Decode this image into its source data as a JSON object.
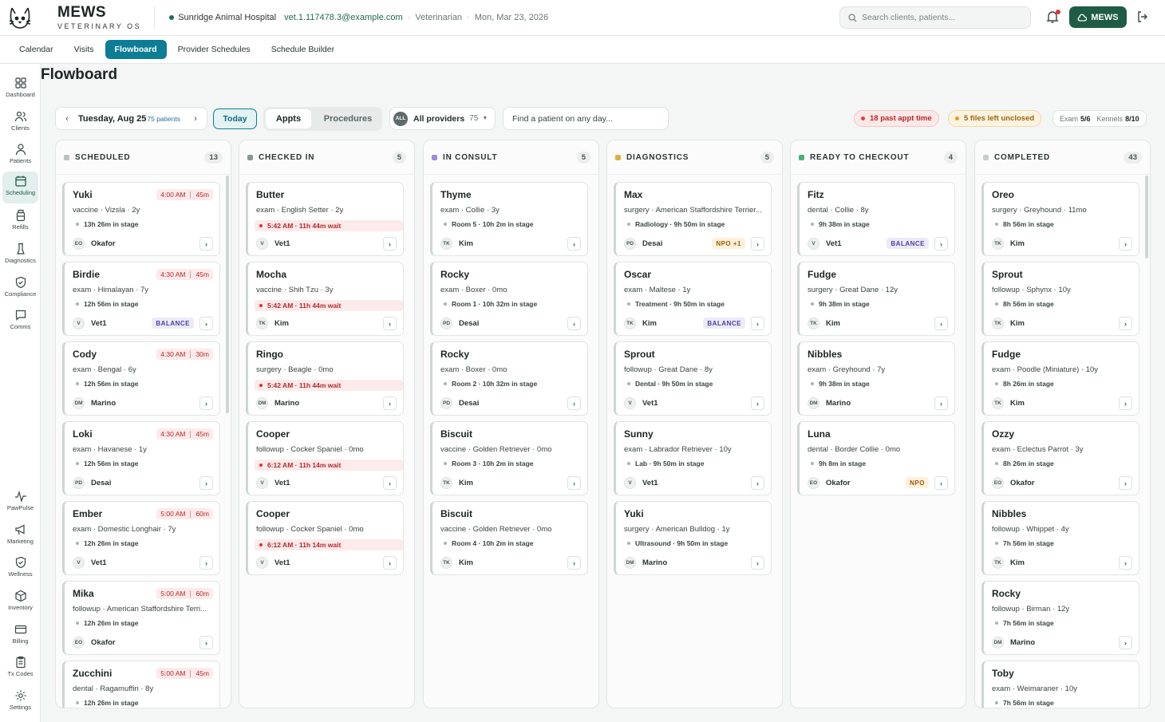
{
  "app": {
    "brand": "MEWS",
    "brand_sub": "VETERINARY OS"
  },
  "header": {
    "hospital": "Sunridge Animal Hospital",
    "user_email": "vet.1.117478.3@example.com",
    "role": "Veterinarian",
    "date": "Mon, Mar 23, 2026",
    "search_placeholder": "Search clients, patients...",
    "mews_button": "MEWS"
  },
  "nav_tabs": [
    {
      "label": "Calendar",
      "active": false
    },
    {
      "label": "Visits",
      "active": false
    },
    {
      "label": "Flowboard",
      "active": true
    },
    {
      "label": "Provider Schedules",
      "active": false
    },
    {
      "label": "Schedule Builder",
      "active": false
    }
  ],
  "sidebar": {
    "items": [
      {
        "label": "Dashboard",
        "icon": "grid-icon"
      },
      {
        "label": "Clients",
        "icon": "users-icon"
      },
      {
        "label": "Patients",
        "icon": "user-icon"
      },
      {
        "label": "Scheduling",
        "icon": "calendar-icon",
        "active": true
      },
      {
        "label": "Refills",
        "icon": "bottle-icon"
      },
      {
        "label": "Diagnostics",
        "icon": "flask-icon"
      },
      {
        "label": "Compliance",
        "icon": "shield-check-icon"
      },
      {
        "label": "Comms",
        "icon": "chat-icon"
      },
      {
        "label": "PawPulse",
        "icon": "pulse-icon"
      },
      {
        "label": "Marketing",
        "icon": "megaphone-icon"
      },
      {
        "label": "Wellness",
        "icon": "shield-check-icon"
      },
      {
        "label": "Inventory",
        "icon": "box-icon"
      },
      {
        "label": "Billing",
        "icon": "card-icon"
      },
      {
        "label": "Tx Codes",
        "icon": "clipboard-icon"
      },
      {
        "label": "Settings",
        "icon": "gear-icon"
      }
    ]
  },
  "page": {
    "title": "Flowboard"
  },
  "toolbar": {
    "date": "Tuesday, Aug 25",
    "patient_count": "75 patients",
    "today": "Today",
    "segment_on": "Appts",
    "segment_off": "Procedures",
    "providers_badge": "ALL",
    "providers_label": "All providers",
    "providers_count": "75",
    "find_placeholder": "Find a patient on any day...",
    "past_appt": "18 past appt time",
    "files_unclosed": "5 files left unclosed",
    "exam_label": "Exam",
    "exam_value": "5/6",
    "kennels_label": "Kennels",
    "kennels_value": "8/10"
  },
  "colors": {
    "accent": "#0d7d96",
    "brand": "#1f5c45",
    "scheduled": "#b9c2c2",
    "checked_in": "#8a9797",
    "in_consult": "#9c8ce0",
    "diagnostics": "#e0b040",
    "ready": "#4cb07a",
    "completed": "#c5cccc"
  },
  "columns": [
    {
      "title": "SCHEDULED",
      "count": "13",
      "cards": [
        {
          "name": "Yuki",
          "time": "4:00 AM",
          "dur": "45m",
          "desc": "vaccine · Vizsla · 2y",
          "stage": "13h 26m in stage",
          "initials": "EO",
          "provider": "Okafor",
          "badge": ""
        },
        {
          "name": "Birdie",
          "time": "4:30 AM",
          "dur": "45m",
          "desc": "exam · Himalayan · 7y",
          "stage": "12h 56m in stage",
          "initials": "V",
          "provider": "Vet1",
          "badge": "BALANCE"
        },
        {
          "name": "Cody",
          "time": "4:30 AM",
          "dur": "30m",
          "desc": "exam · Bengal · 6y",
          "stage": "12h 56m in stage",
          "initials": "DM",
          "provider": "Marino",
          "badge": ""
        },
        {
          "name": "Loki",
          "time": "4:30 AM",
          "dur": "45m",
          "desc": "exam · Havanese · 1y",
          "stage": "12h 56m in stage",
          "initials": "PD",
          "provider": "Desai",
          "badge": ""
        },
        {
          "name": "Ember",
          "time": "5:00 AM",
          "dur": "60m",
          "desc": "exam · Domestic Longhair · 7y",
          "stage": "12h 26m in stage",
          "initials": "V",
          "provider": "Vet1",
          "badge": ""
        },
        {
          "name": "Mika",
          "time": "5:00 AM",
          "dur": "60m",
          "desc": "followup · American Staffordshire Terri...",
          "stage": "12h 26m in stage",
          "initials": "EO",
          "provider": "Okafor",
          "badge": ""
        },
        {
          "name": "Zucchini",
          "time": "5:00 AM",
          "dur": "45m",
          "desc": "dental · Ragamuffin · 8y",
          "stage": "12h 26m in stage",
          "initials": "",
          "provider": "",
          "badge": ""
        }
      ]
    },
    {
      "title": "CHECKED IN",
      "count": "5",
      "cards": [
        {
          "name": "Butter",
          "desc": "exam · English Setter · 2y",
          "stage": "5:42 AM · 11h 44m wait",
          "wait": true,
          "initials": "V",
          "provider": "Vet1",
          "badge": ""
        },
        {
          "name": "Mocha",
          "desc": "vaccine · Shih Tzu · 3y",
          "stage": "5:42 AM · 11h 44m wait",
          "wait": true,
          "initials": "TK",
          "provider": "Kim",
          "badge": ""
        },
        {
          "name": "Ringo",
          "desc": "surgery · Beagle · 0mo",
          "stage": "5:42 AM · 11h 44m wait",
          "wait": true,
          "initials": "DM",
          "provider": "Marino",
          "badge": ""
        },
        {
          "name": "Cooper",
          "desc": "followup · Cocker Spaniel · 0mo",
          "stage": "6:12 AM · 11h 14m wait",
          "wait": true,
          "initials": "V",
          "provider": "Vet1",
          "badge": ""
        },
        {
          "name": "Cooper",
          "desc": "followup · Cocker Spaniel · 0mo",
          "stage": "6:12 AM · 11h 14m wait",
          "wait": true,
          "initials": "V",
          "provider": "Vet1",
          "badge": ""
        }
      ]
    },
    {
      "title": "IN CONSULT",
      "count": "5",
      "cards": [
        {
          "name": "Thyme",
          "desc": "exam · Collie · 3y",
          "stage": "Room 5 · 10h 2m in stage",
          "initials": "TK",
          "provider": "Kim",
          "badge": ""
        },
        {
          "name": "Rocky",
          "desc": "exam · Boxer · 0mo",
          "stage": "Room 1 · 10h 32m in stage",
          "initials": "PD",
          "provider": "Desai",
          "badge": ""
        },
        {
          "name": "Rocky",
          "desc": "exam · Boxer · 0mo",
          "stage": "Room 2 · 10h 32m in stage",
          "initials": "PD",
          "provider": "Desai",
          "badge": ""
        },
        {
          "name": "Biscuit",
          "desc": "vaccine · Golden Retriever · 0mo",
          "stage": "Room 3 · 10h 2m in stage",
          "initials": "TK",
          "provider": "Kim",
          "badge": ""
        },
        {
          "name": "Biscuit",
          "desc": "vaccine · Golden Retriever · 0mo",
          "stage": "Room 4 · 10h 2m in stage",
          "initials": "TK",
          "provider": "Kim",
          "badge": ""
        }
      ]
    },
    {
      "title": "DIAGNOSTICS",
      "count": "5",
      "cards": [
        {
          "name": "Max",
          "desc": "surgery · American Staffordshire Terrier...",
          "stage": "Radiology · 9h 50m in stage",
          "initials": "PD",
          "provider": "Desai",
          "badge": "NPO +1"
        },
        {
          "name": "Oscar",
          "desc": "exam · Maltese · 1y",
          "stage": "Treatment · 9h 50m in stage",
          "initials": "TK",
          "provider": "Kim",
          "badge": "BALANCE"
        },
        {
          "name": "Sprout",
          "desc": "followup · Great Dane · 8y",
          "stage": "Dental · 9h 50m in stage",
          "initials": "V",
          "provider": "Vet1",
          "badge": ""
        },
        {
          "name": "Sunny",
          "desc": "exam · Labrador Retriever · 10y",
          "stage": "Lab · 9h 50m in stage",
          "initials": "V",
          "provider": "Vet1",
          "badge": ""
        },
        {
          "name": "Yuki",
          "desc": "surgery · American Bulldog · 1y",
          "stage": "Ultrasound · 9h 50m in stage",
          "initials": "DM",
          "provider": "Marino",
          "badge": ""
        }
      ]
    },
    {
      "title": "READY TO CHECKOUT",
      "count": "4",
      "cards": [
        {
          "name": "Fitz",
          "desc": "dental · Collie · 8y",
          "stage": "9h 38m in stage",
          "initials": "V",
          "provider": "Vet1",
          "badge": "BALANCE"
        },
        {
          "name": "Fudge",
          "desc": "surgery · Great Dane · 12y",
          "stage": "9h 38m in stage",
          "initials": "TK",
          "provider": "Kim",
          "badge": ""
        },
        {
          "name": "Nibbles",
          "desc": "exam · Greyhound · 7y",
          "stage": "9h 38m in stage",
          "initials": "DM",
          "provider": "Marino",
          "badge": ""
        },
        {
          "name": "Luna",
          "desc": "dental · Border Collie · 0mo",
          "stage": "9h 8m in stage",
          "initials": "EO",
          "provider": "Okafor",
          "badge": "NPO"
        }
      ]
    },
    {
      "title": "COMPLETED",
      "count": "43",
      "cards": [
        {
          "name": "Oreo",
          "desc": "surgery · Greyhound · 11mo",
          "stage": "8h 56m in stage",
          "initials": "TK",
          "provider": "Kim",
          "badge": ""
        },
        {
          "name": "Sprout",
          "desc": "followup · Sphynx · 10y",
          "stage": "8h 56m in stage",
          "initials": "TK",
          "provider": "Kim",
          "badge": ""
        },
        {
          "name": "Fudge",
          "desc": "exam · Poodle (Miniature) · 10y",
          "stage": "8h 26m in stage",
          "initials": "TK",
          "provider": "Kim",
          "badge": ""
        },
        {
          "name": "Ozzy",
          "desc": "exam · Eclectus Parrot · 3y",
          "stage": "8h 26m in stage",
          "initials": "EO",
          "provider": "Okafor",
          "badge": ""
        },
        {
          "name": "Nibbles",
          "desc": "followup · Whippet · 4y",
          "stage": "7h 56m in stage",
          "initials": "TK",
          "provider": "Kim",
          "badge": ""
        },
        {
          "name": "Rocky",
          "desc": "followup · Birman · 12y",
          "stage": "7h 56m in stage",
          "initials": "DM",
          "provider": "Marino",
          "badge": ""
        },
        {
          "name": "Toby",
          "desc": "exam · Weimaraner · 10y",
          "stage": "7h 56m in stage",
          "initials": "",
          "provider": "",
          "badge": ""
        }
      ]
    }
  ]
}
